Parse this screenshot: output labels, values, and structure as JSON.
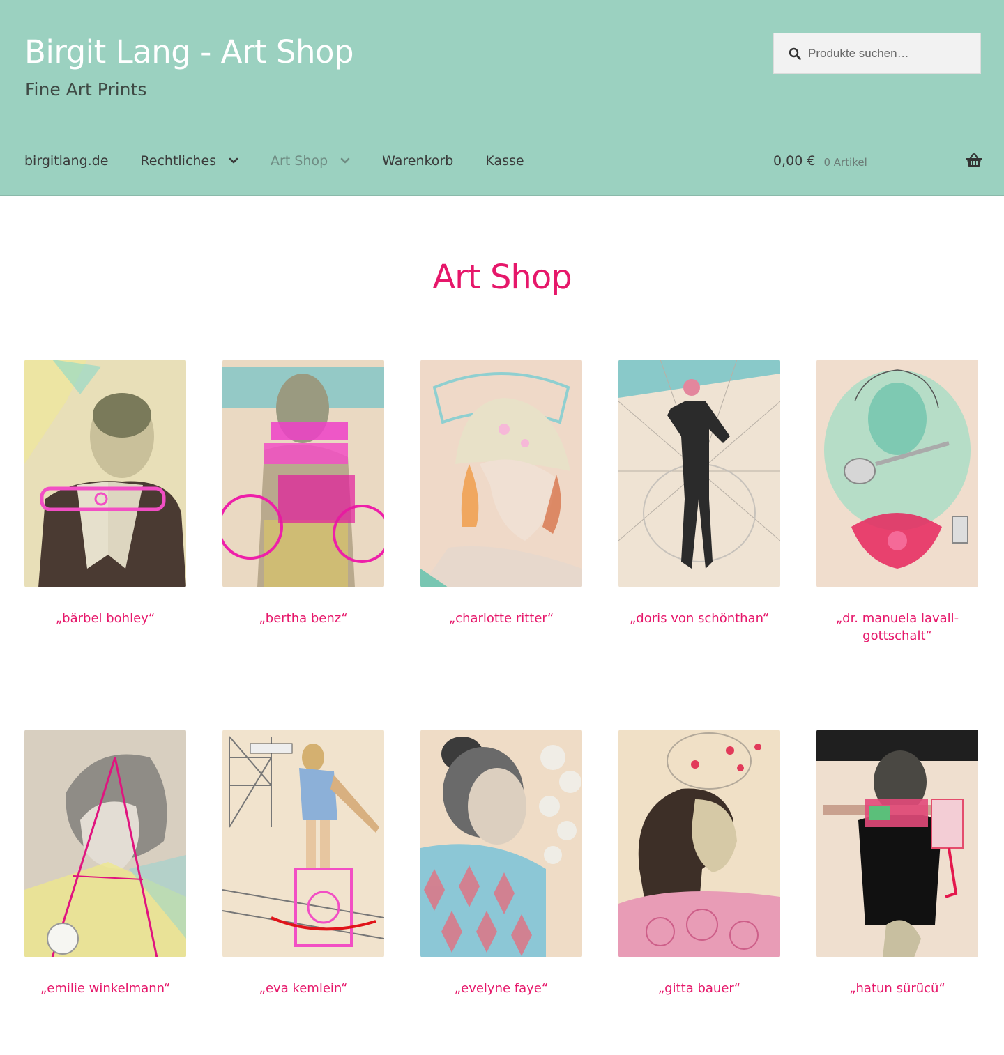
{
  "header": {
    "site_title": "Birgit Lang - Art Shop",
    "tagline": "Fine Art Prints",
    "search_placeholder": "Produkte suchen…",
    "nav": [
      {
        "label": "birgitlang.de",
        "dropdown": false,
        "current": false
      },
      {
        "label": "Rechtliches",
        "dropdown": true,
        "current": false
      },
      {
        "label": "Art Shop",
        "dropdown": true,
        "current": true
      },
      {
        "label": "Warenkorb",
        "dropdown": false,
        "current": false
      },
      {
        "label": "Kasse",
        "dropdown": false,
        "current": false
      }
    ],
    "cart": {
      "amount": "0,00 €",
      "count": "0 Artikel"
    }
  },
  "main": {
    "title": "Art Shop",
    "products": [
      {
        "name": "„bärbel bohley“"
      },
      {
        "name": "„bertha benz“"
      },
      {
        "name": "„charlotte ritter“"
      },
      {
        "name": "„doris von schönthan“"
      },
      {
        "name": "„dr. manuela lavall-gottschalt“"
      },
      {
        "name": "„emilie winkelmann“"
      },
      {
        "name": "„eva kemlein“"
      },
      {
        "name": "„evelyne faye“"
      },
      {
        "name": "„gitta bauer“"
      },
      {
        "name": "„hatun sürücü“"
      }
    ]
  },
  "colors": {
    "header_bg": "#9bd1c0",
    "accent": "#e6176a",
    "title_white": "#ffffff"
  },
  "icons": [
    "search-icon",
    "chevron-down-icon",
    "basket-icon"
  ]
}
